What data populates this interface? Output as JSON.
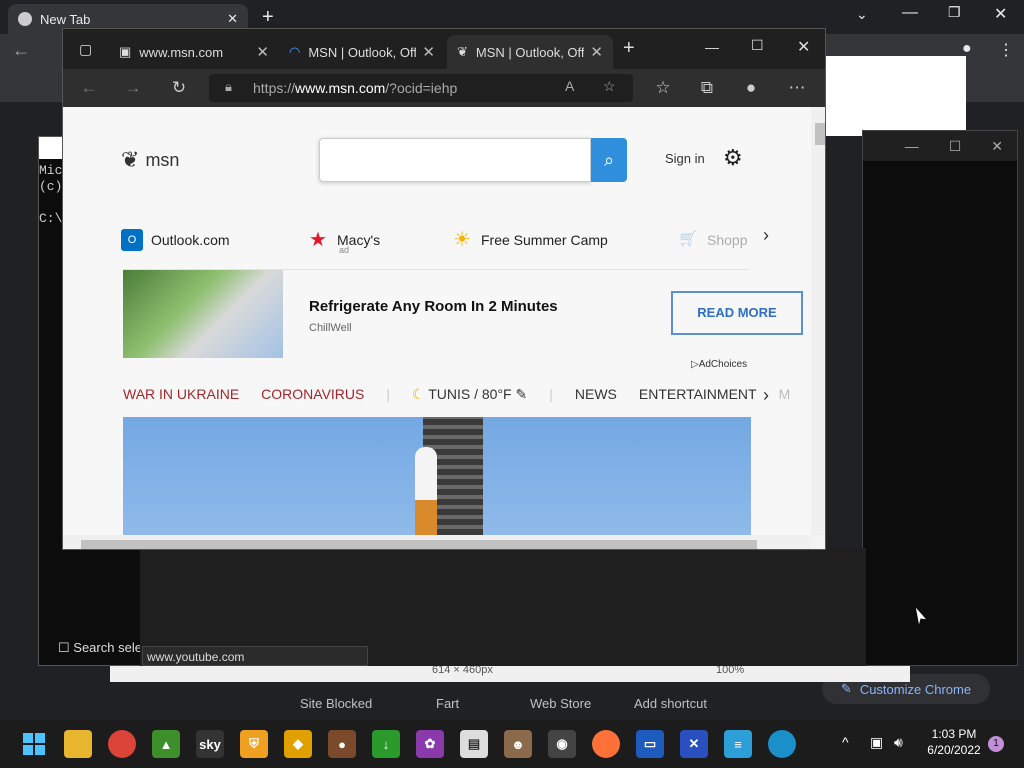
{
  "chrome": {
    "tab_title": "New Tab",
    "shortcuts": [
      "Site Blocked",
      "Fart",
      "Web Store",
      "Add shortcut"
    ],
    "customize_label": "Customize Chrome",
    "hover_url": "www.youtube.com"
  },
  "cmd": {
    "lines": [
      "Mic",
      "(c)",
      "",
      "C:\\"
    ]
  },
  "paint": {
    "search_label": "Search sele",
    "dimensions": "614 × 460px",
    "zoom": "100%"
  },
  "edge": {
    "tabs": [
      {
        "label": "www.msn.com"
      },
      {
        "label": "MSN | Outlook, Off"
      },
      {
        "label": "MSN | Outlook, Off"
      }
    ],
    "address": {
      "prefix": "https://",
      "host": "www.msn.com",
      "path": "/?ocid=iehp"
    }
  },
  "msn": {
    "logo_text": "msn",
    "search_placeholder": "",
    "signin": "Sign in",
    "quick_links": [
      {
        "label": "Outlook.com",
        "sub": "",
        "icon": "outlook-icon",
        "color": "#0072c6"
      },
      {
        "label": "Macy's",
        "sub": "ad",
        "icon": "macys-star-icon",
        "color": "#e21a2c"
      },
      {
        "label": "Free Summer Camp",
        "sub": "",
        "icon": "sun-icon",
        "color": "#f5b400"
      },
      {
        "label": "Shopp",
        "sub": "",
        "icon": "cart-icon",
        "color": "#3a96dd"
      }
    ],
    "ad": {
      "title": "Refrigerate Any Room In 2 Minutes",
      "brand": "ChillWell",
      "cta": "READ MORE",
      "adchoices": "AdChoices"
    },
    "topics": [
      "WAR IN UKRAINE",
      "CORONAVIRUS"
    ],
    "weather": "TUNIS / 80°F",
    "sections": [
      "NEWS",
      "ENTERTAINMENT",
      "M"
    ]
  },
  "taskbar": {
    "time": "1:03 PM",
    "date": "6/20/2022",
    "notification_count": "1"
  }
}
